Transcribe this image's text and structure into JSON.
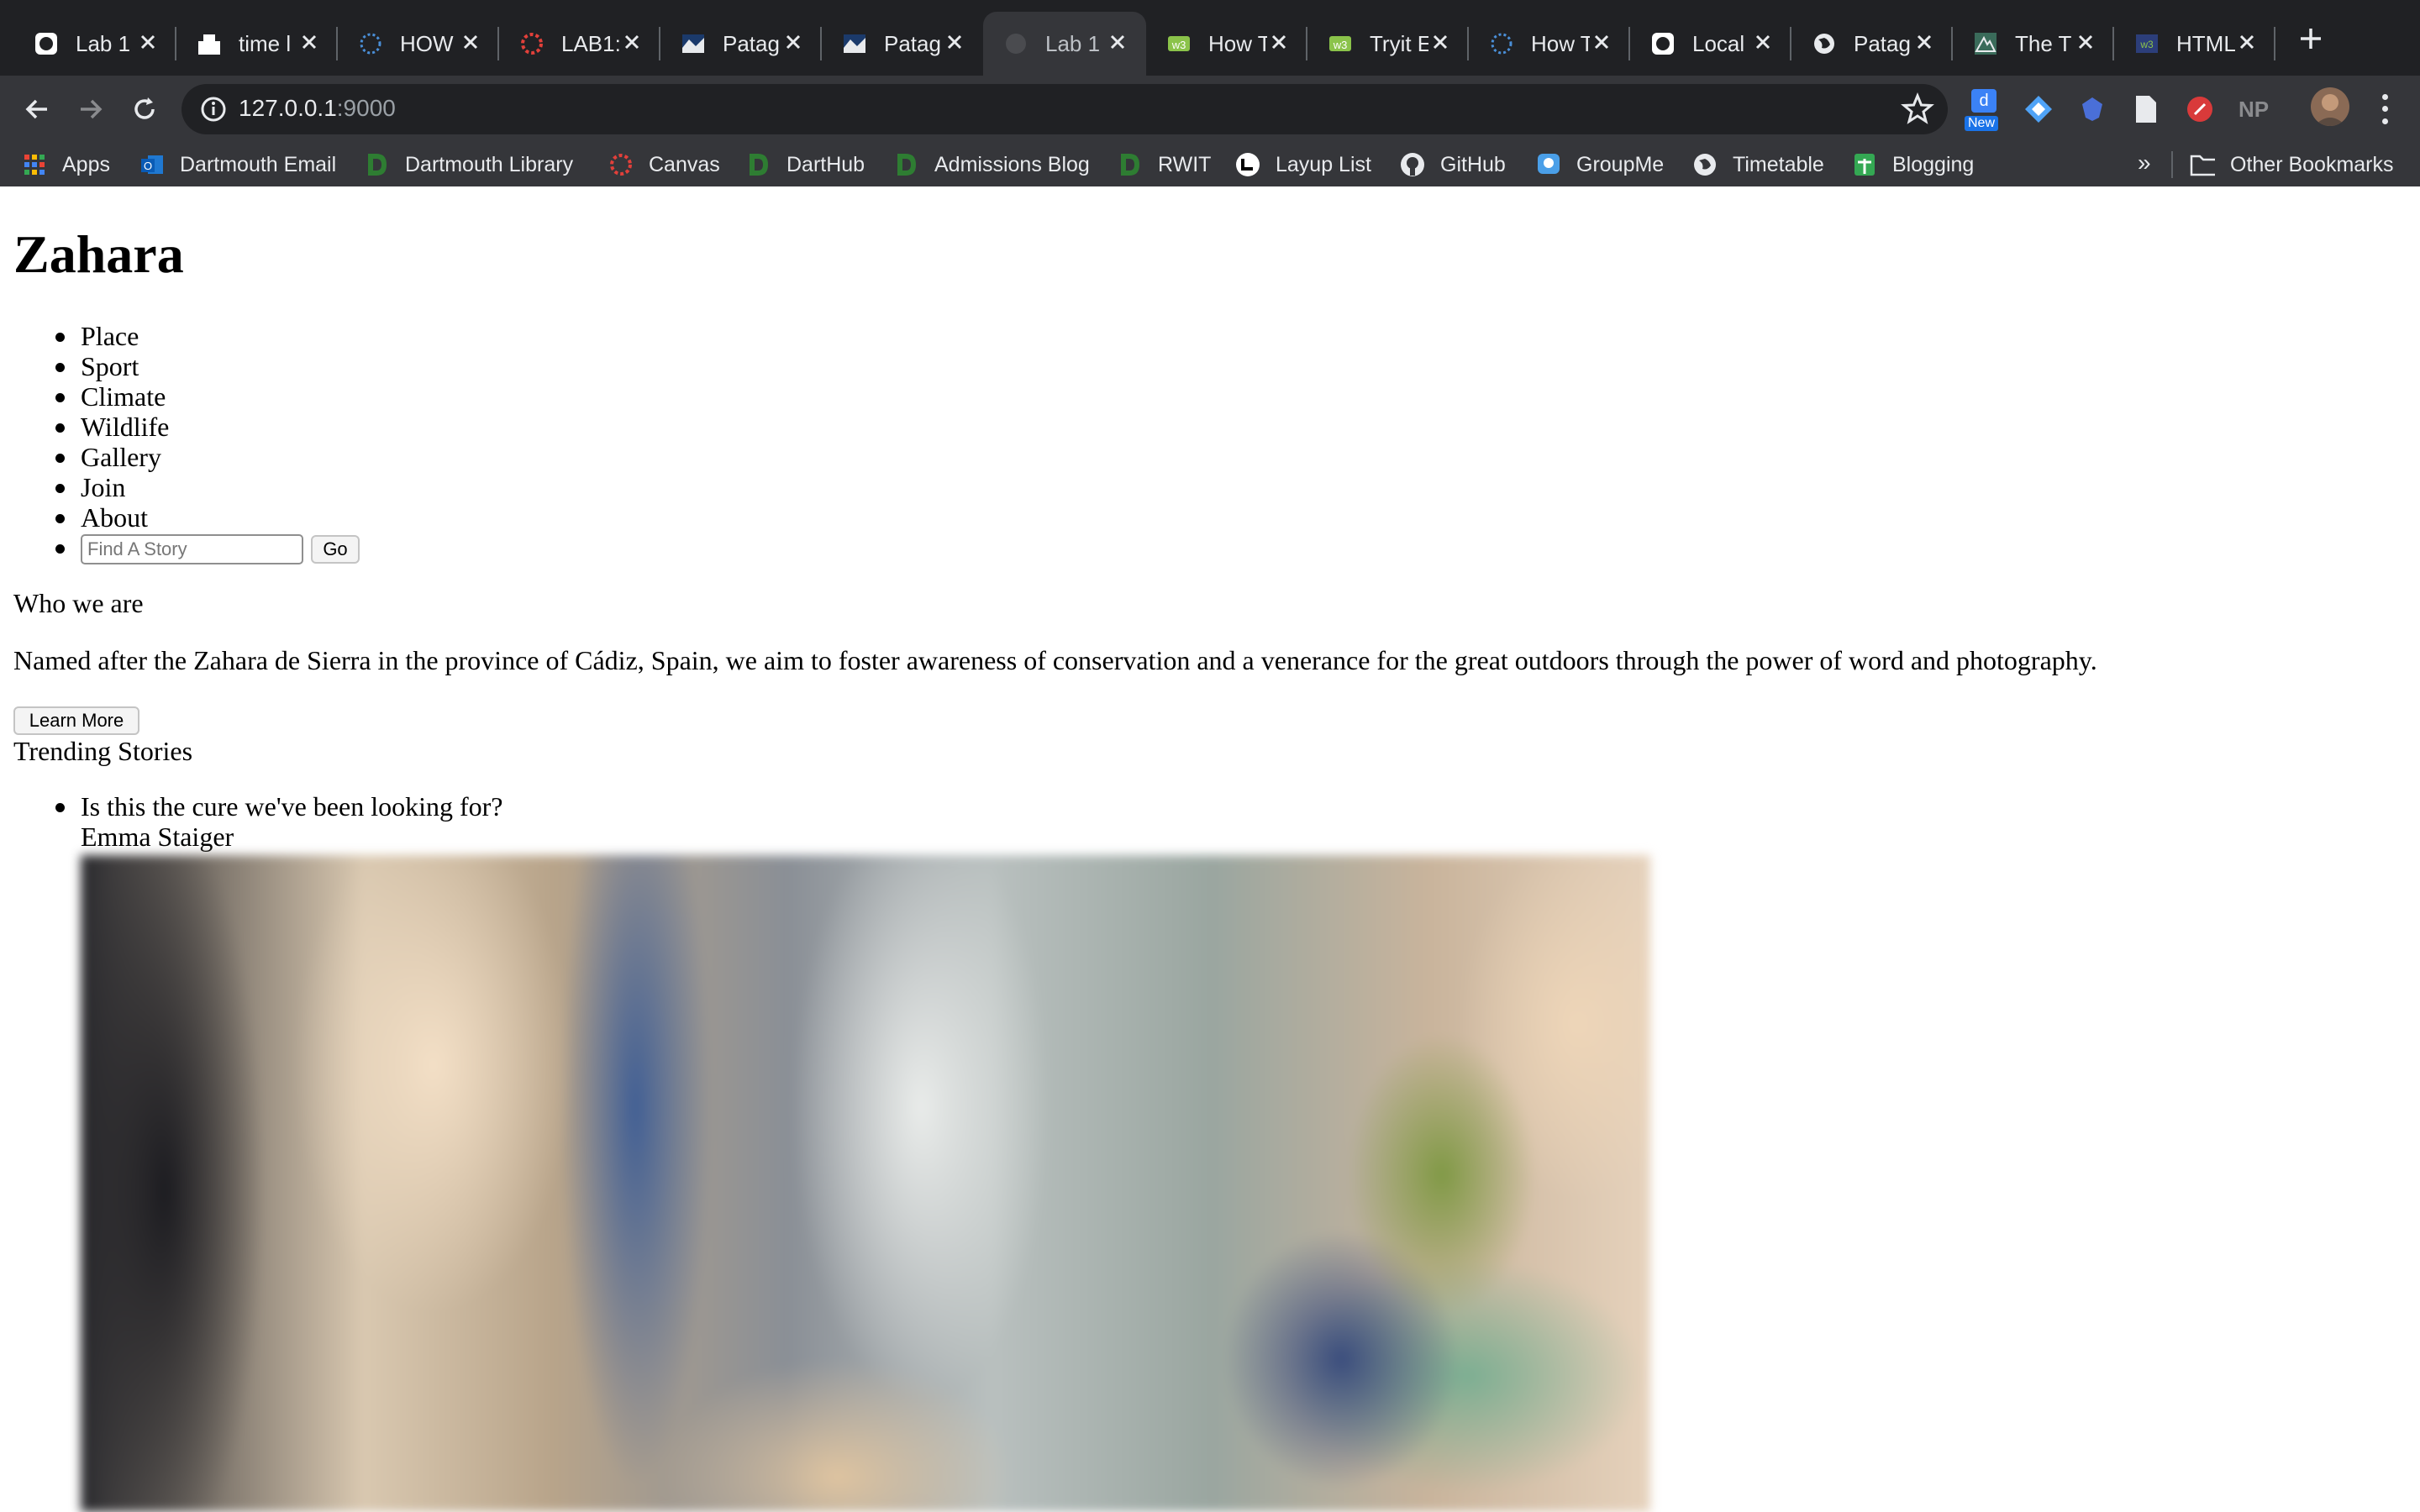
{
  "browser": {
    "tabs": [
      {
        "label": "Lab 1",
        "icon": "github-icon"
      },
      {
        "label": "time l",
        "icon": "site-icon"
      },
      {
        "label": "HOW",
        "icon": "loader-icon"
      },
      {
        "label": "LAB1:",
        "icon": "canvas-icon"
      },
      {
        "label": "Patag",
        "icon": "patagonia-icon"
      },
      {
        "label": "Patag",
        "icon": "patagonia-icon"
      },
      {
        "label": "Lab 1",
        "icon": "globe-icon",
        "active": true
      },
      {
        "label": "How T",
        "icon": "w3schools-icon"
      },
      {
        "label": "Tryit E",
        "icon": "w3schools-icon"
      },
      {
        "label": "How T",
        "icon": "loader-icon"
      },
      {
        "label": "Local",
        "icon": "github-icon"
      },
      {
        "label": "Patag",
        "icon": "globe-icon"
      },
      {
        "label": "The T",
        "icon": "mountain-icon"
      },
      {
        "label": "HTML",
        "icon": "w3-icon"
      }
    ],
    "address": {
      "host": "127.0.0.1",
      "port": ":9000"
    },
    "extension_badge": "New",
    "extension_np": "NP",
    "bookmarks": [
      {
        "label": "Apps",
        "icon": "apps-grid-icon"
      },
      {
        "label": "Dartmouth Email",
        "icon": "outlook-icon"
      },
      {
        "label": "Dartmouth Library",
        "icon": "dartmouth-d-icon"
      },
      {
        "label": "Canvas",
        "icon": "canvas-icon"
      },
      {
        "label": "DartHub",
        "icon": "dartmouth-d-icon"
      },
      {
        "label": "Admissions Blog",
        "icon": "dartmouth-d-icon"
      },
      {
        "label": "RWIT",
        "icon": "dartmouth-d-icon"
      },
      {
        "label": "Layup List",
        "icon": "layup-icon"
      },
      {
        "label": "GitHub",
        "icon": "github-icon"
      },
      {
        "label": "GroupMe",
        "icon": "groupme-icon"
      },
      {
        "label": "Timetable",
        "icon": "globe-icon"
      },
      {
        "label": "Blogging",
        "icon": "sheets-icon"
      }
    ],
    "bookmarks_more": "»",
    "other_bookmarks": "Other Bookmarks"
  },
  "page": {
    "title": "Zahara",
    "nav": [
      "Place",
      "Sport",
      "Climate",
      "Wildlife",
      "Gallery",
      "Join",
      "About"
    ],
    "search": {
      "placeholder": "Find A Story",
      "button": "Go"
    },
    "about_heading": "Who we are",
    "about_text": "Named after the Zahara de Sierra in the province of Cádiz, Spain, we aim to foster awareness of conservation and a venerance for the great outdoors through the power of word and photography.",
    "learn_more": "Learn More",
    "trending_heading": "Trending Stories",
    "stories": [
      {
        "title": "Is this the cure we've been looking for?",
        "author": "Emma Staiger"
      }
    ]
  },
  "colors": {
    "tabstrip": "#202124",
    "toolbar": "#35363a",
    "text_light": "#e8eaed",
    "page_bg": "#ffffff"
  }
}
